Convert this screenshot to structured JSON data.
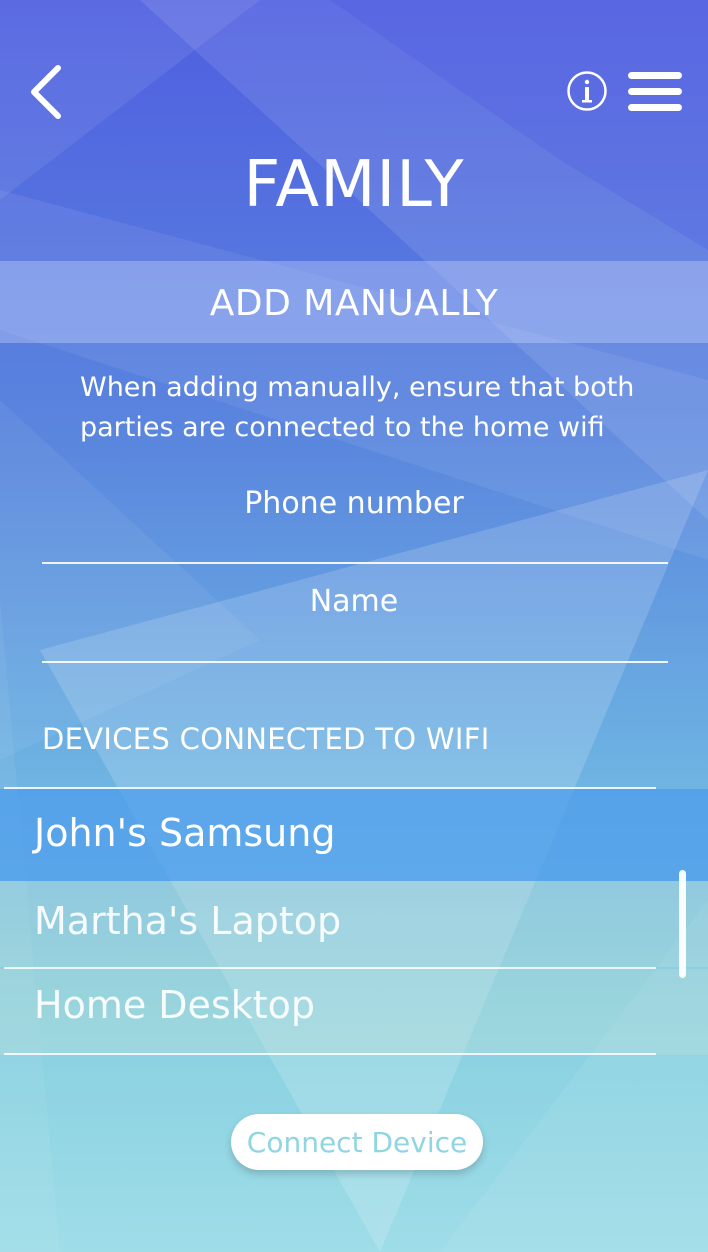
{
  "header": {
    "back_icon": "chevron-left-icon",
    "info_icon": "info-icon",
    "menu_icon": "hamburger-menu-icon",
    "title": "FAMILY"
  },
  "section": {
    "title": "ADD MANUALLY",
    "instructions_line1": "When adding manually, ensure that both",
    "instructions_line2": "parties are connected to the home wifi"
  },
  "form": {
    "phone_label": "Phone number",
    "name_label": "Name"
  },
  "devices": {
    "header": "DEVICES CONNECTED TO WIFI",
    "items": [
      {
        "label": "John's Samsung",
        "selected": true
      },
      {
        "label": "Martha's Laptop",
        "selected": false
      },
      {
        "label": "Home Desktop",
        "selected": false
      }
    ]
  },
  "actions": {
    "connect_label": "Connect Device"
  },
  "colors": {
    "gradient_top": "#4f5ee0",
    "gradient_bottom": "#9fdde8",
    "selected_row": "#4e9cec",
    "button_text": "#8fd5e2"
  }
}
